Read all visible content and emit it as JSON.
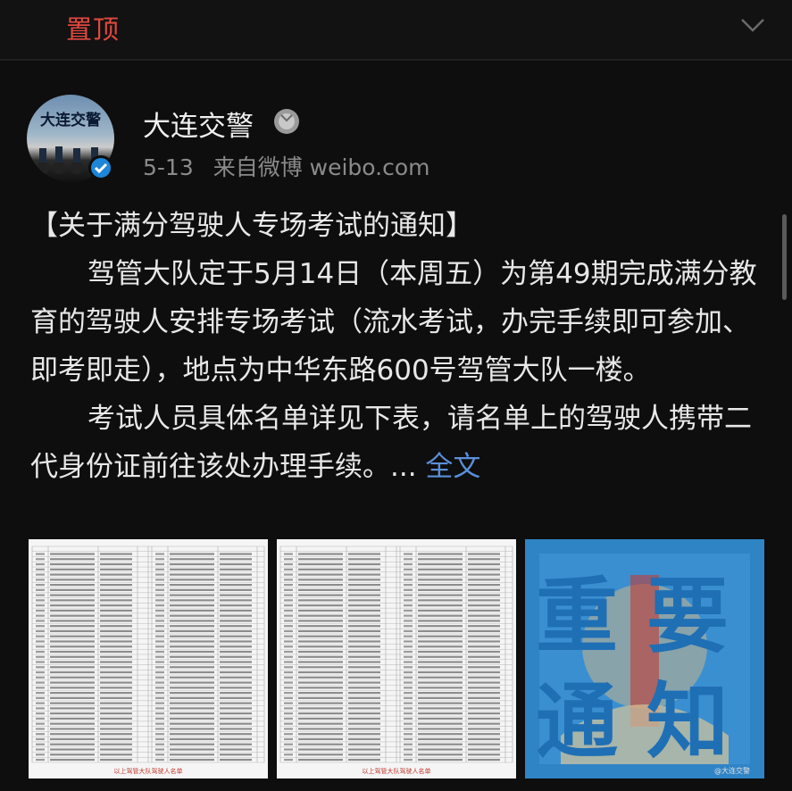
{
  "header": {
    "pin_label": "置顶"
  },
  "post": {
    "author": "大连交警",
    "avatar_text": "大连交警",
    "date": "5-13",
    "source": "来自微博 weibo.com",
    "title": "【关于满分驾驶人专场考试的通知】",
    "paragraph1": "驾管大队定于5月14日（本周五）为第49期完成满分教育的驾驶人安排专场考试（流水考试，办完手续即可参加、即考即走），地点为中华东路600号驾管大队一楼。",
    "paragraph2": "考试人员具体名单详见下表，请名单上的驾驶人携带二代身份证前往该处办理手续。...",
    "full_text_link": "全文",
    "images": [
      {
        "kind": "table",
        "caption": "以上驾管大队驾驶人名单"
      },
      {
        "kind": "table",
        "caption": "以上驾管大队驾驶人名单"
      },
      {
        "kind": "poster",
        "text": [
          "重",
          "要",
          "通",
          "知"
        ],
        "watermark": "@大连交警"
      }
    ]
  },
  "colors": {
    "background": "#0e0e0e",
    "pin_red": "#e0493f",
    "link_blue": "#5b8fd8",
    "verify_blue": "#1d86d8",
    "poster_blue": "#2f84c6"
  },
  "icons": [
    "chevron-down-icon",
    "medal-icon",
    "verified-icon",
    "table-image",
    "poster-image"
  ]
}
